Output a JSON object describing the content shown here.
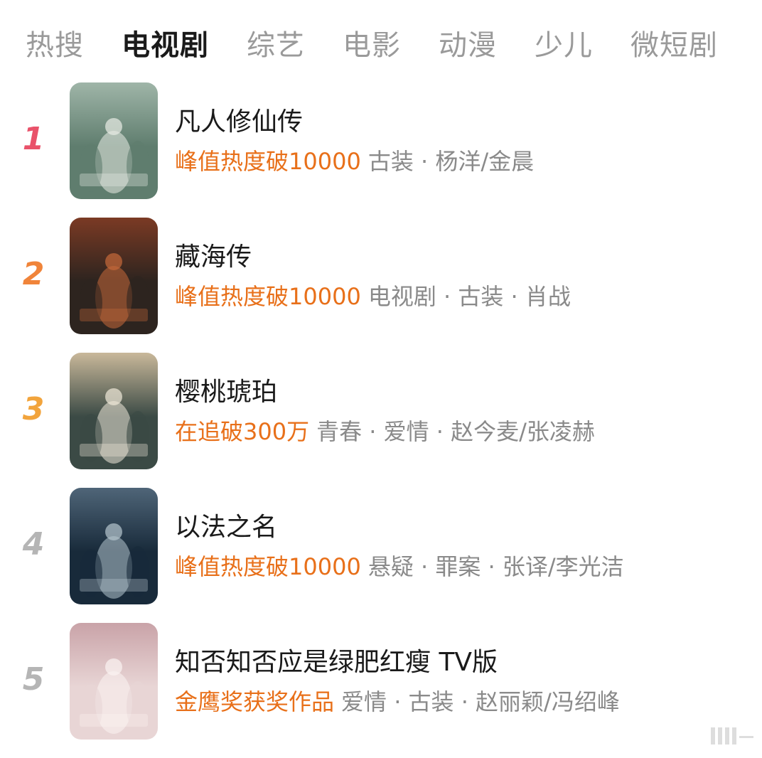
{
  "tabs": [
    {
      "label": "热搜",
      "active": false
    },
    {
      "label": "电视剧",
      "active": true
    },
    {
      "label": "综艺",
      "active": false
    },
    {
      "label": "电影",
      "active": false
    },
    {
      "label": "动漫",
      "active": false
    },
    {
      "label": "少儿",
      "active": false
    },
    {
      "label": "微短剧",
      "active": false
    }
  ],
  "colors": {
    "accent": "#e8701a",
    "rank_1": "#e9526a",
    "rank_2": "#f0843a",
    "rank_3": "#f2a43c",
    "rank_other": "#b5b5b5",
    "tag_gray": "#8a8a8a"
  },
  "items": [
    {
      "rank": "1",
      "title": "凡人修仙传",
      "hot": "峰值热度破10000",
      "tags": "古装 · 杨洋/金晨"
    },
    {
      "rank": "2",
      "title": "藏海传",
      "hot": "峰值热度破10000",
      "tags": "电视剧 · 古装 · 肖战"
    },
    {
      "rank": "3",
      "title": "樱桃琥珀",
      "hot": "在追破300万",
      "tags": "青春 · 爱情 · 赵今麦/张凌赫"
    },
    {
      "rank": "4",
      "title": "以法之名",
      "hot": "峰值热度破10000",
      "tags": "悬疑 · 罪案 · 张译/李光洁"
    },
    {
      "rank": "5",
      "title": "知否知否应是绿肥红瘦 TV版",
      "hot": "金鹰奖获奖作品",
      "tags": "爱情 · 古装 · 赵丽颖/冯绍峰"
    }
  ],
  "posters": [
    {
      "icon": "poster-image",
      "palette": [
        "#5f7d6e",
        "#9fb5a8",
        "#e9ece6"
      ]
    },
    {
      "icon": "poster-image",
      "palette": [
        "#2d241f",
        "#7b3a24",
        "#c8693a"
      ]
    },
    {
      "icon": "poster-image",
      "palette": [
        "#3b4a45",
        "#c9b89a",
        "#f1e9da"
      ]
    },
    {
      "icon": "poster-image",
      "palette": [
        "#182a3a",
        "#4f6578",
        "#b7c6cf"
      ]
    },
    {
      "icon": "poster-image",
      "palette": [
        "#e8d5d5",
        "#c9a3a8",
        "#fbf4f2"
      ]
    }
  ]
}
